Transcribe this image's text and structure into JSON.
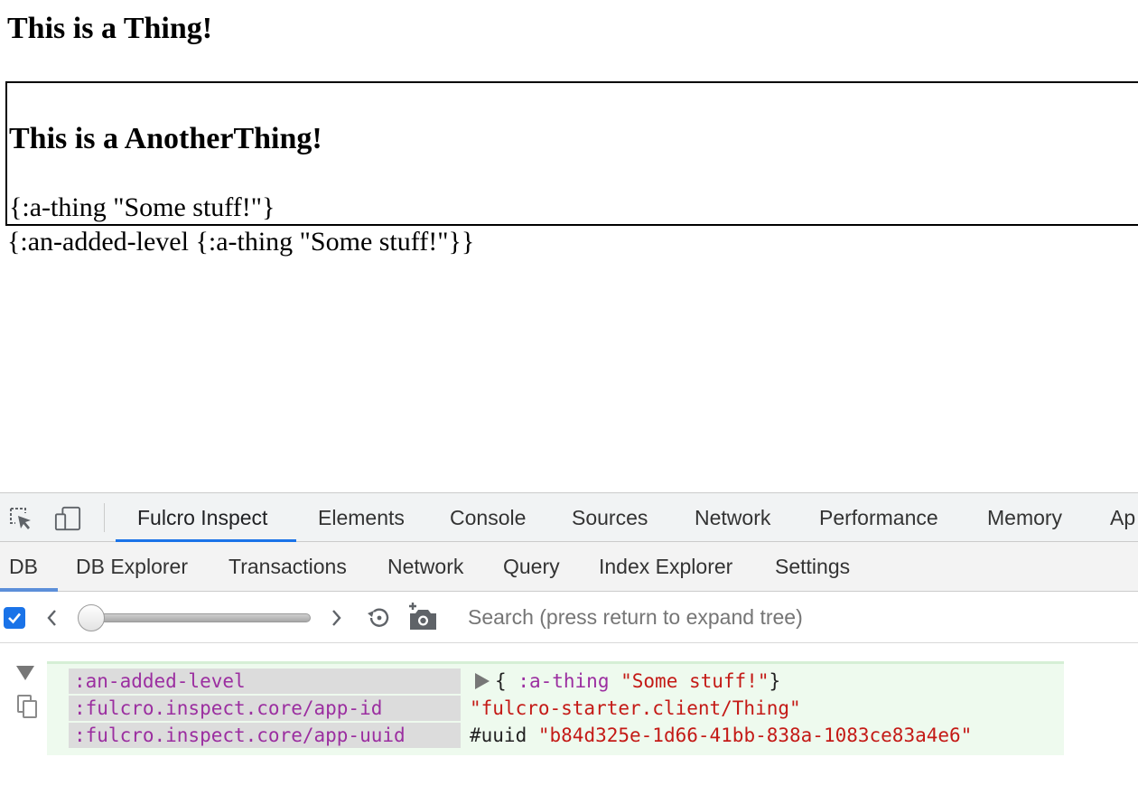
{
  "page": {
    "heading": "This is a Thing!",
    "child_heading": "This is a AnotherThing!",
    "child_props": "{:a-thing \"Some stuff!\"}",
    "parent_props": "{:an-added-level {:a-thing \"Some stuff!\"}}"
  },
  "devtools": {
    "main_tabs": [
      {
        "label": "Fulcro Inspect",
        "active": true
      },
      {
        "label": "Elements"
      },
      {
        "label": "Console"
      },
      {
        "label": "Sources"
      },
      {
        "label": "Network"
      },
      {
        "label": "Performance"
      },
      {
        "label": "Memory"
      },
      {
        "label": "Ap"
      }
    ],
    "sub_tabs": [
      {
        "label": "DB",
        "active": true
      },
      {
        "label": "DB Explorer"
      },
      {
        "label": "Transactions"
      },
      {
        "label": "Network"
      },
      {
        "label": "Query"
      },
      {
        "label": "Index Explorer"
      },
      {
        "label": "Settings"
      }
    ],
    "history": {
      "checkbox_checked": true,
      "slider_position": 0,
      "search_placeholder": "Search (press return to expand tree)"
    },
    "db": {
      "rows": [
        {
          "key": ":an-added-level",
          "open_brace": "{",
          "inner_key": ":a-thing",
          "inner_value": "\"Some stuff!\"",
          "close_brace": "}"
        },
        {
          "key": ":fulcro.inspect.core/app-id",
          "value": "\"fulcro-starter.client/Thing\""
        },
        {
          "key": ":fulcro.inspect.core/app-uuid",
          "tag": "#uuid",
          "value": "\"b84d325e-1d66-41bb-838a-1083ce83a4e6\""
        }
      ]
    },
    "icons": {
      "inspect": "inspect-element-icon",
      "device": "device-toolbar-icon",
      "prev": "chevron-left-icon",
      "next": "chevron-right-icon",
      "history": "history-reset-icon",
      "snapshot": "camera-add-icon",
      "collapse": "triangle-down-icon",
      "copy": "copy-icon"
    },
    "colors": {
      "accent": "#1a73e8",
      "keyword": "#9b2ea0",
      "string": "#c41a16",
      "db_background": "#eefaee"
    }
  }
}
